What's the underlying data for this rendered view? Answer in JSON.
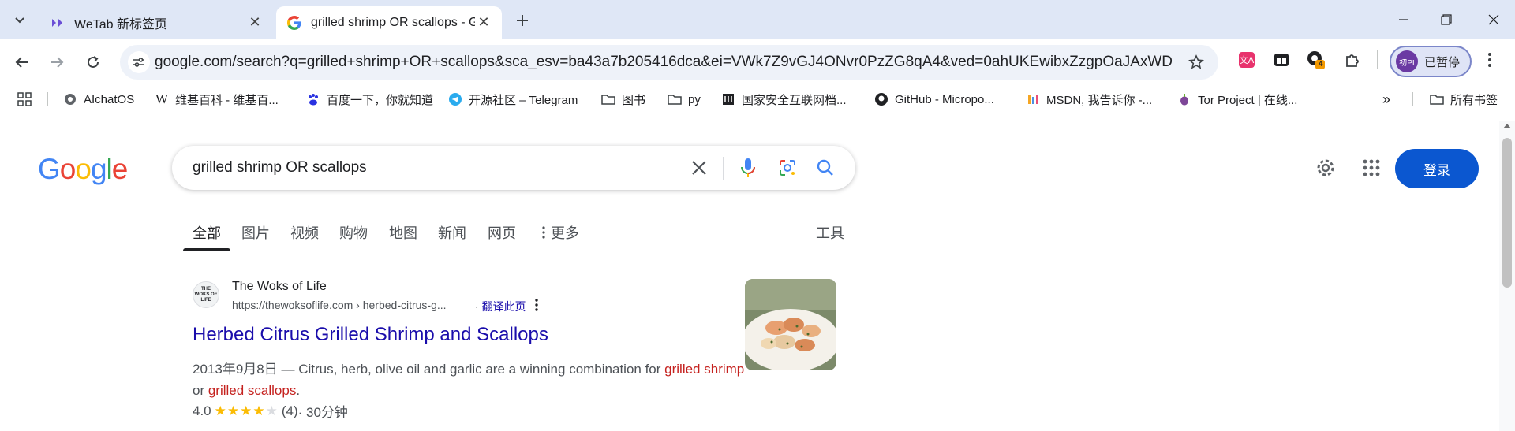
{
  "tabs": [
    {
      "title": "WeTab 新标签页",
      "active": false
    },
    {
      "title": "grilled shrimp OR scallops - G",
      "active": true
    }
  ],
  "window_controls": {
    "minimize": "—",
    "maximize": "❐",
    "close": "✕"
  },
  "toolbar": {
    "url": "google.com/search?q=grilled+shrimp+OR+scallops&sca_esv=ba43a7b205416dca&ei=VWk7Z9vGJ4ONvr0PzZG8qA4&ved=0ahUKEwibxZzgpOaJAxWD...",
    "extension_badge": "4",
    "profile_avatar_text": "初PI",
    "profile_label": "已暂停"
  },
  "bookmarks": [
    {
      "label": "AIchatOS",
      "icon": "globe-icon"
    },
    {
      "label": "维基百科 - 维基百...",
      "icon": "wikipedia-icon"
    },
    {
      "label": "百度一下，你就知道",
      "icon": "baidu-icon"
    },
    {
      "label": "开源社区 – Telegram",
      "icon": "telegram-icon"
    },
    {
      "label": "图书",
      "icon": "folder-icon"
    },
    {
      "label": "py",
      "icon": "folder-icon"
    },
    {
      "label": "国家安全互联网档...",
      "icon": "archive-icon"
    },
    {
      "label": "GitHub - Micropo...",
      "icon": "github-icon"
    },
    {
      "label": "MSDN, 我告诉你 -...",
      "icon": "msdn-icon"
    },
    {
      "label": "Tor Project | 在线...",
      "icon": "tor-icon"
    }
  ],
  "bookmarks_overflow": "»",
  "bookmarks_all": "所有书签",
  "google": {
    "query": "grilled shrimp OR scallops",
    "login_label": "登录",
    "nav_tabs": [
      "全部",
      "图片",
      "视频",
      "购物",
      "地图",
      "新闻",
      "网页",
      "更多"
    ],
    "tools_label": "工具"
  },
  "result": {
    "site_icon_text": "THE WOKS OF LIFE",
    "site_name": "The Woks of Life",
    "url": "https://thewoksoflife.com › herbed-citrus-g...",
    "translate": "翻译此页",
    "title": "Herbed Citrus Grilled Shrimp and Scallops",
    "snippet_date": "2013年9月8日 — ",
    "snippet_text": "Citrus, herb, olive oil and garlic are a winning combination for ",
    "snippet_hl1": "grilled shrimp",
    "snippet_mid": " or ",
    "snippet_hl2": "grilled scallops",
    "snippet_end": ".",
    "rating_value": "4.0",
    "rating_stars": 4,
    "rating_count": "(4)",
    "rating_time": " · 30分钟"
  },
  "colors": {
    "tabstrip": "#dfe7f6",
    "link": "#1a0dab",
    "highlight": "#c5221f",
    "login": "#0b57d0",
    "star": "#fbbc04"
  }
}
